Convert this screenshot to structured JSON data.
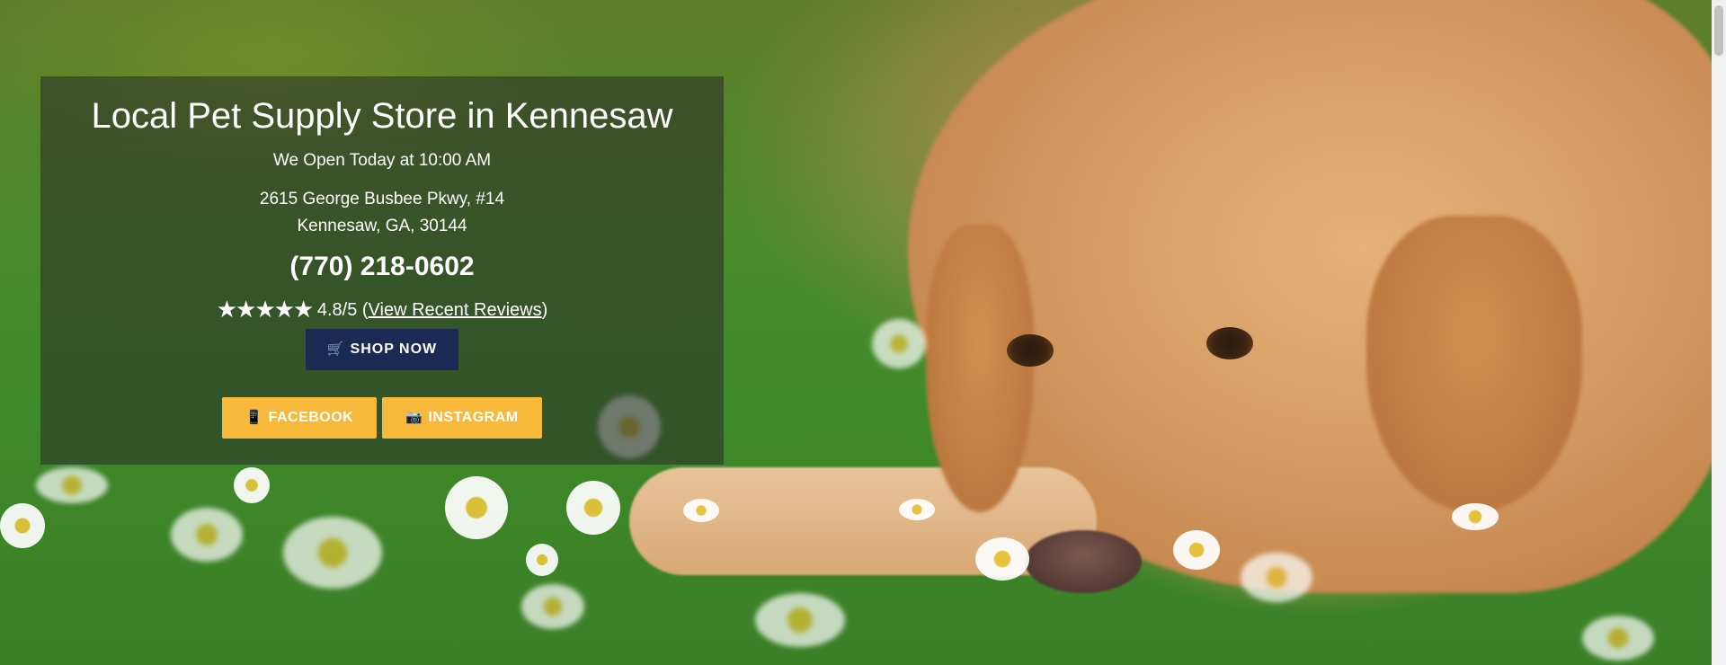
{
  "hero": {
    "title": "Local Pet Supply Store in Kennesaw",
    "open_status": "We Open Today at 10:00 AM",
    "address_line1": "2615 George Busbee Pkwy, #14",
    "address_line2": "Kennesaw, GA, 30144",
    "phone": "(770) 218-0602",
    "rating_stars": "★★★★★",
    "rating_value": "4.8/5",
    "rating_open_paren": "(",
    "reviews_link": "View Recent Reviews",
    "rating_close_paren": ")",
    "shop_icon": "🛒",
    "shop_label": "SHOP NOW",
    "facebook_icon": "📱",
    "facebook_label": "FACEBOOK",
    "instagram_icon": "📷",
    "instagram_label": "INSTAGRAM"
  },
  "colors": {
    "overlay": "rgba(40,40,40,0.55)",
    "shop_button": "#1b2a55",
    "social_button": "#f8b93a",
    "text": "#ffffff"
  },
  "icons": {
    "shop": "cart-icon",
    "facebook": "phone-icon",
    "instagram": "camera-icon",
    "rating": "star-icon"
  }
}
